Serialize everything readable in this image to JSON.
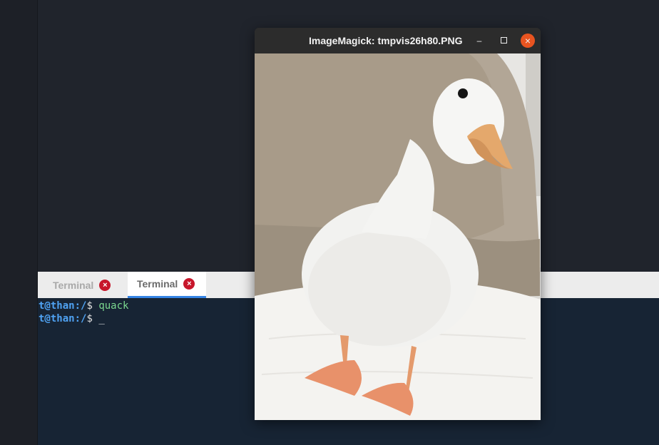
{
  "image_viewer": {
    "title": "ImageMagick: tmpvis26h80.PNG",
    "minimize_symbol": "–",
    "close_symbol": "×",
    "image_subject": "white-duck-photo"
  },
  "terminal": {
    "tabs": [
      {
        "label": "Terminal",
        "active": false
      },
      {
        "label": "Terminal",
        "active": true
      }
    ],
    "lines": [
      {
        "user": "t@than:/",
        "symbol": "$",
        "command": "quack"
      },
      {
        "user": "t@than:/",
        "symbol": "$",
        "command": "_"
      }
    ]
  },
  "colors": {
    "terminal_bg": "#172434",
    "prompt": "#4fa2f2",
    "command": "#7bd88f",
    "close_button": "#e95420",
    "tab_close": "#c7162b",
    "active_tab_indicator": "#3584e4"
  }
}
